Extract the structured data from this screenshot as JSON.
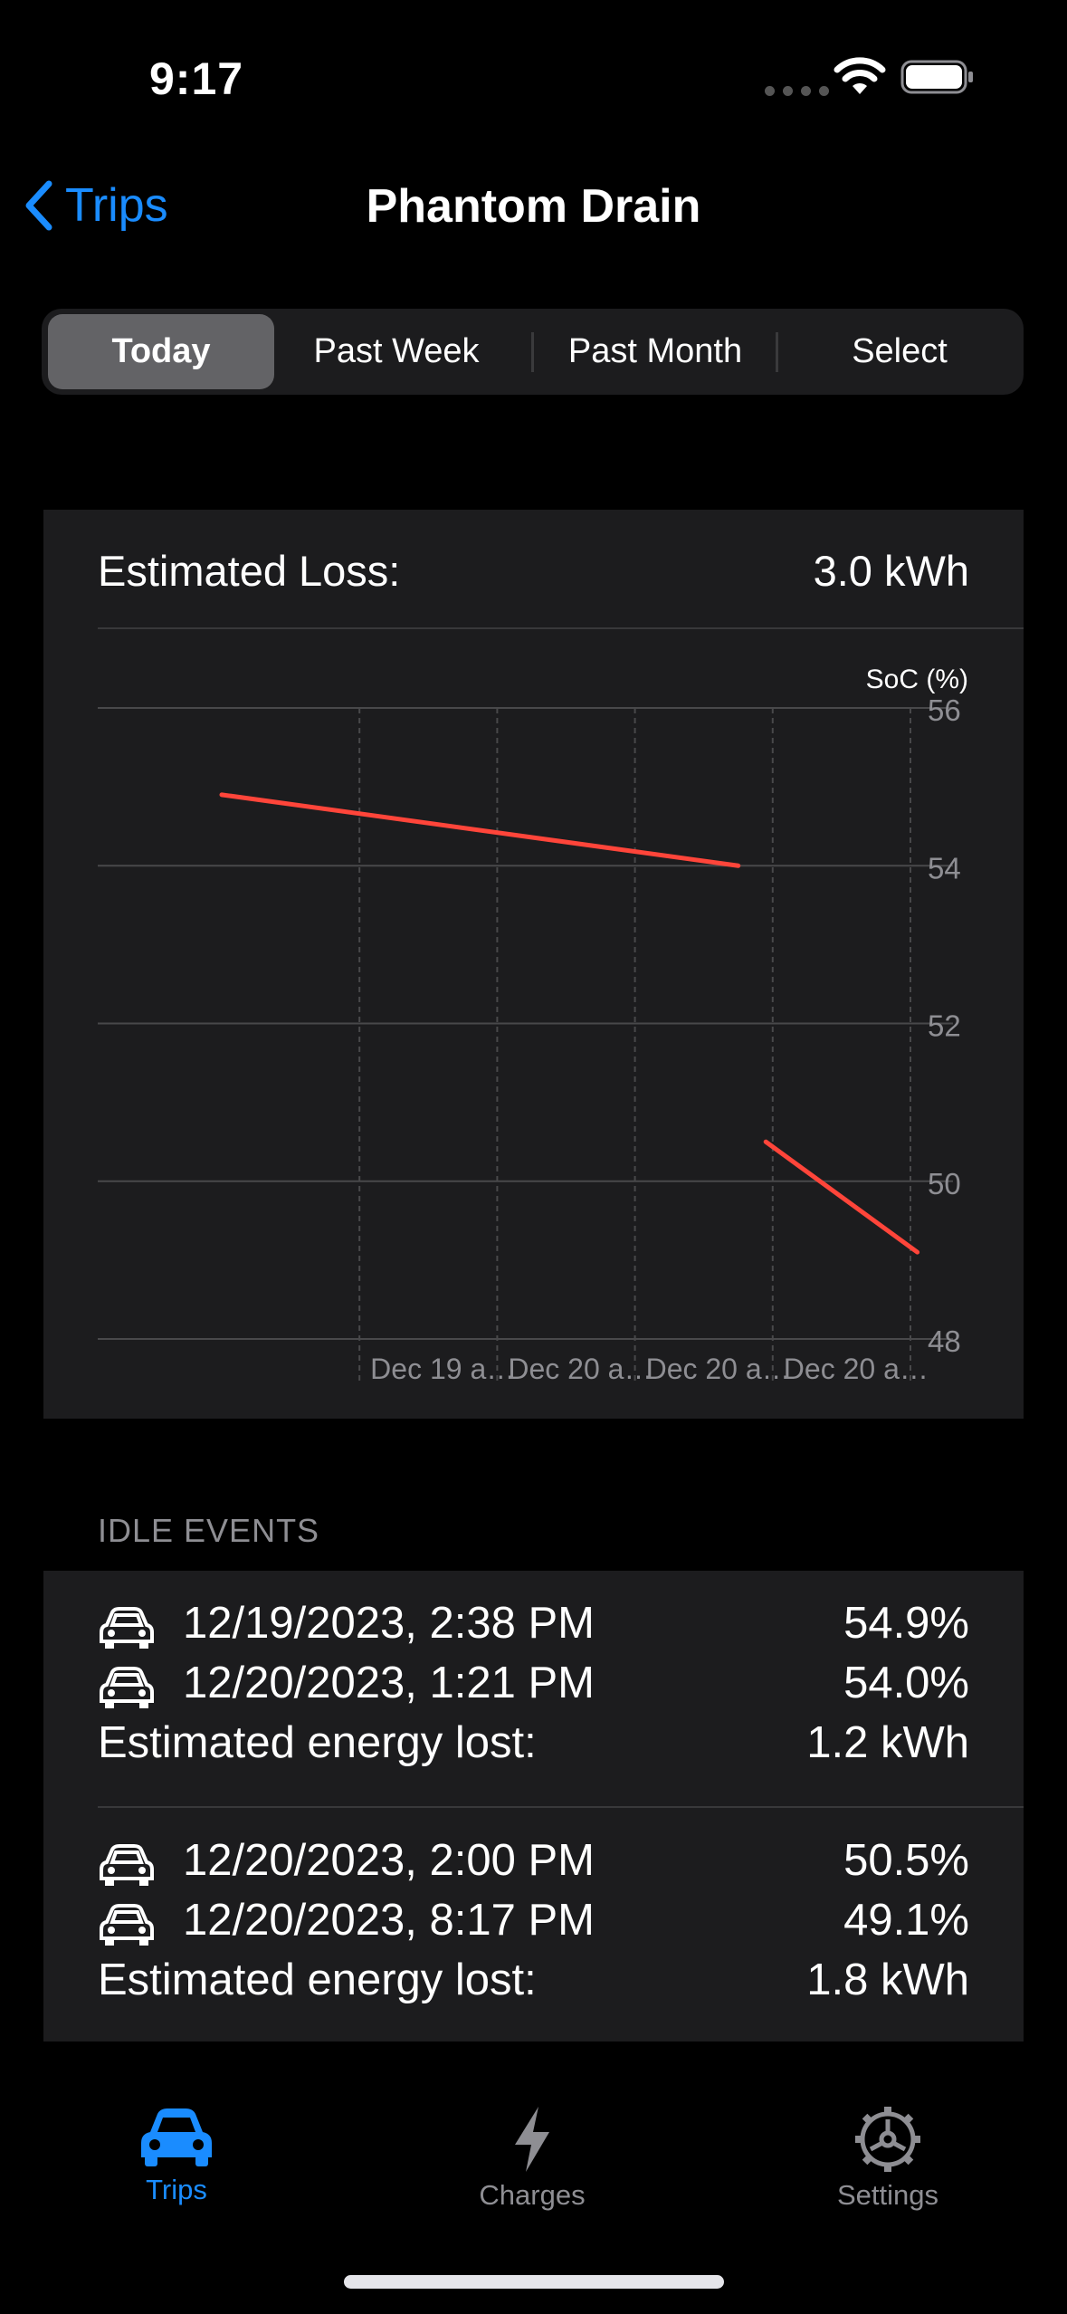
{
  "status_bar": {
    "time": "9:17"
  },
  "nav": {
    "back_label": "Trips",
    "title": "Phantom Drain"
  },
  "segments": [
    "Today",
    "Past Week",
    "Past Month",
    "Select"
  ],
  "summary": {
    "label": "Estimated Loss:",
    "value": "3.0 kWh"
  },
  "chart_data": {
    "type": "line",
    "ylabel": "SoC (%)",
    "ylim": [
      48,
      56
    ],
    "yticks": [
      48,
      50,
      52,
      54,
      56
    ],
    "xtick_labels": [
      "Dec 19 a…",
      "Dec 20 a…",
      "Dec 20 a…",
      "Dec 20 a…"
    ],
    "series": [
      {
        "color": "#ff453a",
        "points": [
          [
            0.0,
            54.9
          ],
          [
            3.75,
            54.0
          ]
        ]
      },
      {
        "color": "#ff453a",
        "points": [
          [
            3.95,
            50.5
          ],
          [
            5.05,
            49.1
          ]
        ]
      }
    ],
    "xrange": [
      -0.9,
      5.0
    ],
    "grid": true
  },
  "idle_events": {
    "header": "IDLE EVENTS",
    "events": [
      {
        "start": "12/19/2023, 2:38 PM",
        "start_soc": "54.9%",
        "end": "12/20/2023, 1:21 PM",
        "end_soc": "54.0%",
        "lost_label": "Estimated energy lost:",
        "lost_value": "1.2 kWh"
      },
      {
        "start": "12/20/2023, 2:00 PM",
        "start_soc": "50.5%",
        "end": "12/20/2023, 8:17 PM",
        "end_soc": "49.1%",
        "lost_label": "Estimated energy lost:",
        "lost_value": "1.8 kWh"
      }
    ]
  },
  "tabs": [
    {
      "label": "Trips",
      "icon": "car-icon",
      "active": true
    },
    {
      "label": "Charges",
      "icon": "bolt-icon",
      "active": false
    },
    {
      "label": "Settings",
      "icon": "gear-icon",
      "active": false
    }
  ],
  "colors": {
    "accent": "#1a8cff",
    "line": "#ff453a",
    "inactive": "#8e8e93"
  }
}
